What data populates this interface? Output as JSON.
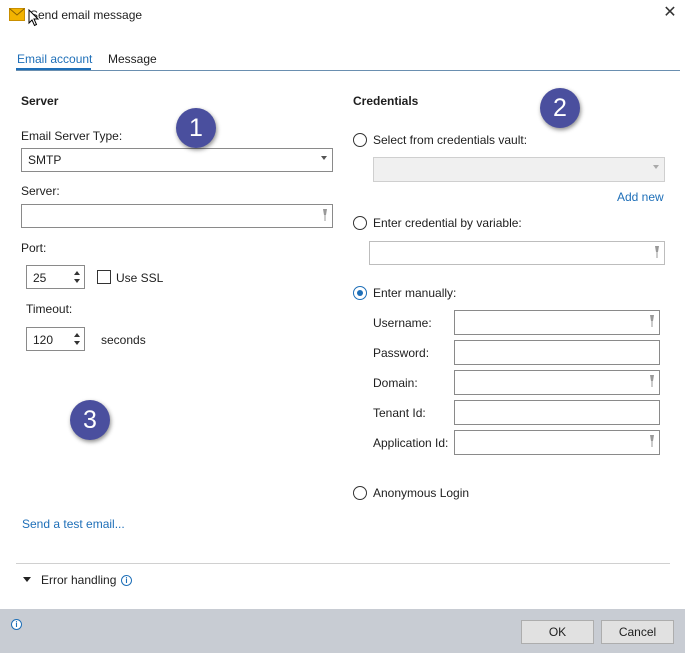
{
  "window": {
    "title": "Send email message",
    "icon": "envelope-icon",
    "close_glyph": "✕"
  },
  "tabs": [
    {
      "label": "Email account",
      "active": true
    },
    {
      "label": "Message",
      "active": false
    }
  ],
  "server": {
    "section_title": "Server",
    "type_label": "Email Server Type:",
    "type_value": "SMTP",
    "server_label": "Server:",
    "server_value": "",
    "port_label": "Port:",
    "port_value": "25",
    "use_ssl_label": "Use SSL",
    "use_ssl_checked": false,
    "timeout_label": "Timeout:",
    "timeout_value": "120",
    "timeout_unit": "seconds",
    "test_email_link": "Send a test email..."
  },
  "credentials": {
    "section_title": "Credentials",
    "vault_option": "Select from credentials vault:",
    "vault_value": "",
    "add_new_link": "Add new",
    "variable_option": "Enter credential by variable:",
    "variable_value": "",
    "manual_option": "Enter manually:",
    "selected": "manual",
    "fields": {
      "username": "Username:",
      "password": "Password:",
      "domain": "Domain:",
      "tenant_id": "Tenant Id:",
      "application_id": "Application Id:"
    },
    "anonymous_option": "Anonymous Login"
  },
  "badges": [
    "1",
    "2",
    "3"
  ],
  "error_handling": {
    "label": "Error handling"
  },
  "footer": {
    "ok_label": "OK",
    "cancel_label": "Cancel"
  },
  "colors": {
    "accent": "#1e6fb8",
    "badge": "#4a4f9e",
    "footer": "#c8ccd3"
  }
}
